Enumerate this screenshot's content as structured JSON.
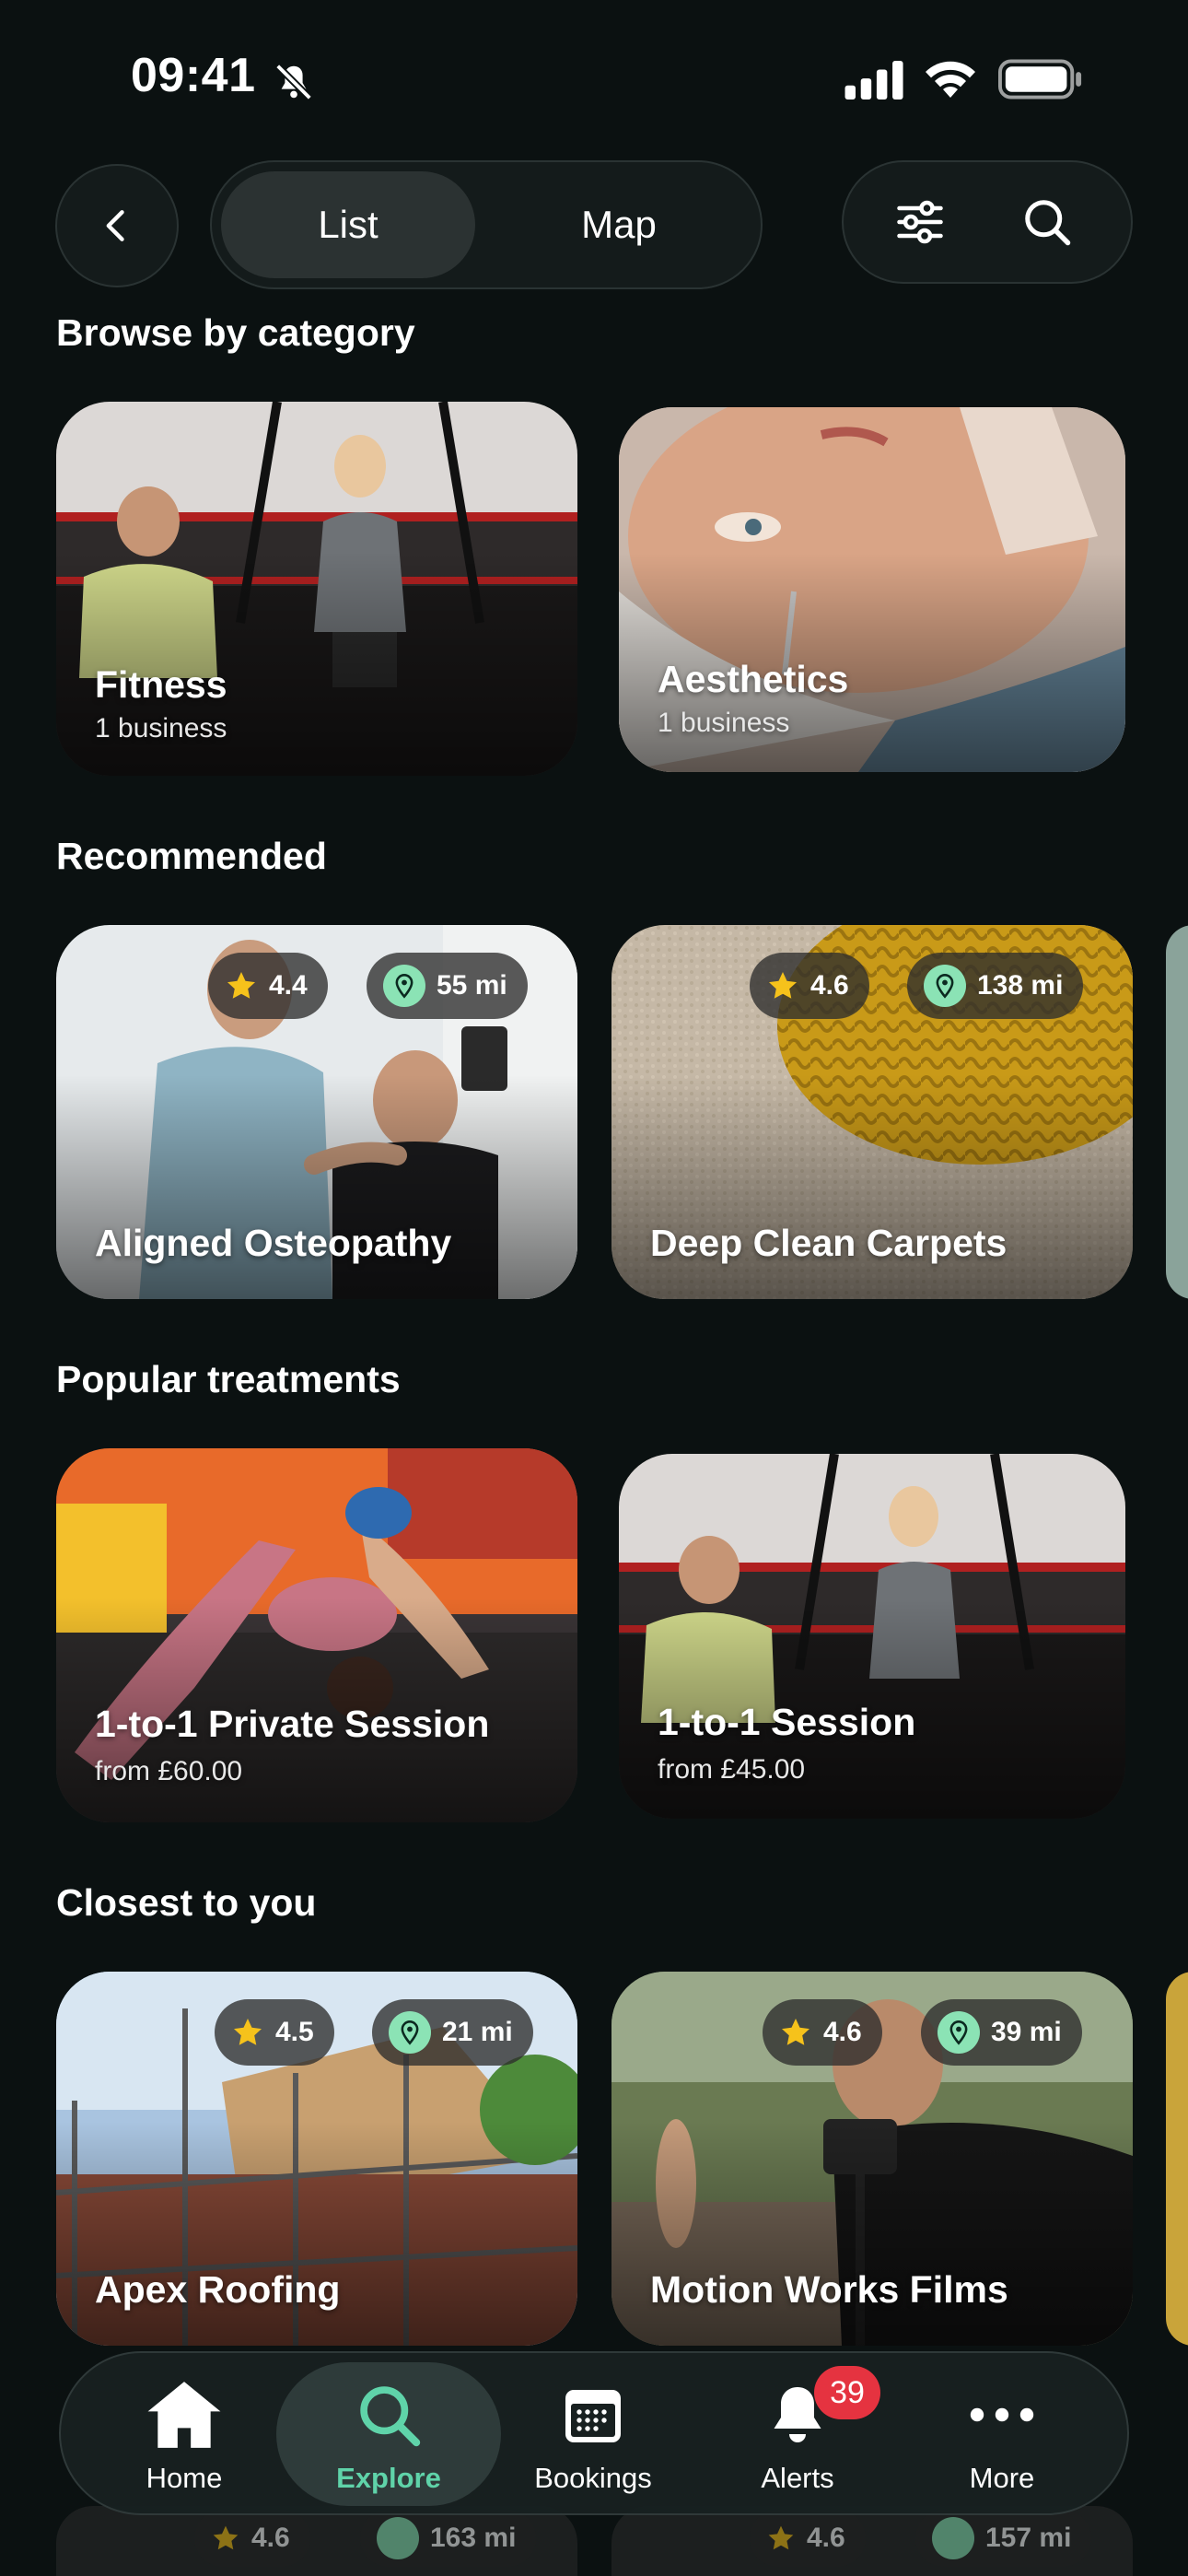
{
  "status_bar": {
    "time": "09:41"
  },
  "topbar": {
    "segments": [
      "List",
      "Map"
    ],
    "active_segment": "List"
  },
  "sections": {
    "categories": {
      "title": "Browse by category",
      "items": [
        {
          "name": "Fitness",
          "subtitle": "1 business"
        },
        {
          "name": "Aesthetics",
          "subtitle": "1 business"
        }
      ]
    },
    "recommended": {
      "title": "Recommended",
      "items": [
        {
          "name": "Aligned Osteopathy",
          "rating": "4.4",
          "distance": "55 mi"
        },
        {
          "name": "Deep Clean Carpets",
          "rating": "4.6",
          "distance": "138 mi"
        }
      ]
    },
    "treatments": {
      "title": "Popular treatments",
      "items": [
        {
          "name": "1-to-1 Private Session",
          "price": "from £60.00"
        },
        {
          "name": "1-to-1 Session",
          "price": "from £45.00"
        }
      ]
    },
    "closest": {
      "title": "Closest to you",
      "items": [
        {
          "name": "Apex Roofing",
          "rating": "4.5",
          "distance": "21 mi"
        },
        {
          "name": "Motion Works Films",
          "rating": "4.6",
          "distance": "39 mi"
        }
      ]
    },
    "peek_row": [
      {
        "rating": "4.6",
        "distance": "163 mi"
      },
      {
        "rating": "4.6",
        "distance": "157 mi"
      }
    ]
  },
  "bottom_nav": {
    "items": [
      {
        "label": "Home",
        "icon": "house-icon"
      },
      {
        "label": "Explore",
        "icon": "search-icon"
      },
      {
        "label": "Bookings",
        "icon": "calendar-icon"
      },
      {
        "label": "Alerts",
        "icon": "bell-icon"
      },
      {
        "label": "More",
        "icon": "ellipsis-icon"
      }
    ],
    "active": "Explore",
    "alerts_badge": "39"
  },
  "colors": {
    "background": "#0b1111",
    "accent": "#5fd3a9",
    "pin": "#8be3b5",
    "star": "#f6c21b",
    "badge_red": "#e53340"
  }
}
